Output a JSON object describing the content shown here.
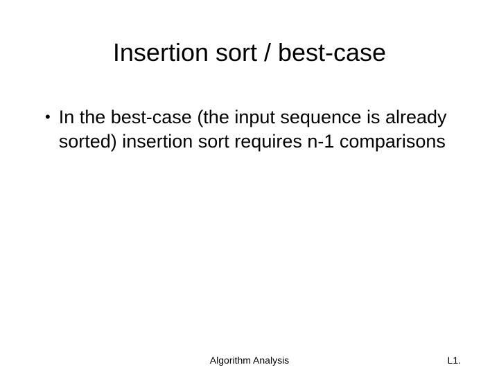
{
  "slide": {
    "title": "Insertion sort / best-case",
    "bullet": {
      "text": "In the best-case (the input sequence is already sorted) insertion sort requires n-1 comparisons"
    },
    "footer": {
      "center": "Algorithm Analysis",
      "right": "L1."
    }
  }
}
